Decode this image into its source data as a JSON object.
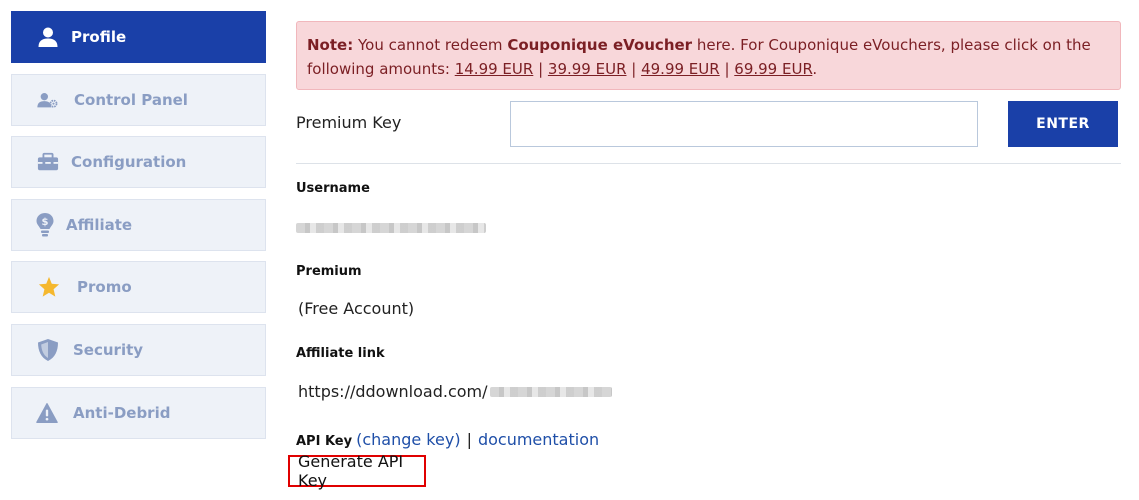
{
  "sidebar": {
    "items": [
      {
        "label": "Profile",
        "icon": "user-icon",
        "active": true
      },
      {
        "label": "Control Panel",
        "icon": "user-gear-icon",
        "active": false
      },
      {
        "label": "Configuration",
        "icon": "toolbox-icon",
        "active": false
      },
      {
        "label": "Affiliate",
        "icon": "lightbulb-dollar-icon",
        "active": false
      },
      {
        "label": "Promo",
        "icon": "star-icon",
        "active": false
      },
      {
        "label": "Security",
        "icon": "shield-icon",
        "active": false
      },
      {
        "label": "Anti-Debrid",
        "icon": "warning-icon",
        "active": false
      }
    ]
  },
  "note": {
    "prefix": "Note:",
    "text1": " You cannot redeem ",
    "product": "Couponique eVoucher",
    "text2": " here. For Couponique eVouchers, please click on the following amounts: ",
    "amounts": [
      "14.99 EUR",
      "39.99 EUR",
      "49.99 EUR",
      "69.99 EUR"
    ],
    "separator": " | ",
    "end": "."
  },
  "premium_key": {
    "label": "Premium Key",
    "value": "",
    "placeholder": "",
    "button": "ENTER"
  },
  "profile": {
    "username_label": "Username",
    "premium_label": "Premium",
    "premium_value": "(Free Account)",
    "affiliate_label": "Affiliate link",
    "affiliate_prefix": "https://ddownload.com/",
    "api_label": "API Key",
    "change_key": "(change key)",
    "api_separator": "|",
    "documentation": "documentation",
    "generate": "Generate API Key"
  },
  "colors": {
    "accent": "#1a40a8",
    "sidebar_inactive_bg": "#eef2f8",
    "sidebar_inactive_text": "#8a9dc3",
    "note_bg": "#f8d7da",
    "note_text": "#7b1f24",
    "highlight": "#e00000"
  }
}
